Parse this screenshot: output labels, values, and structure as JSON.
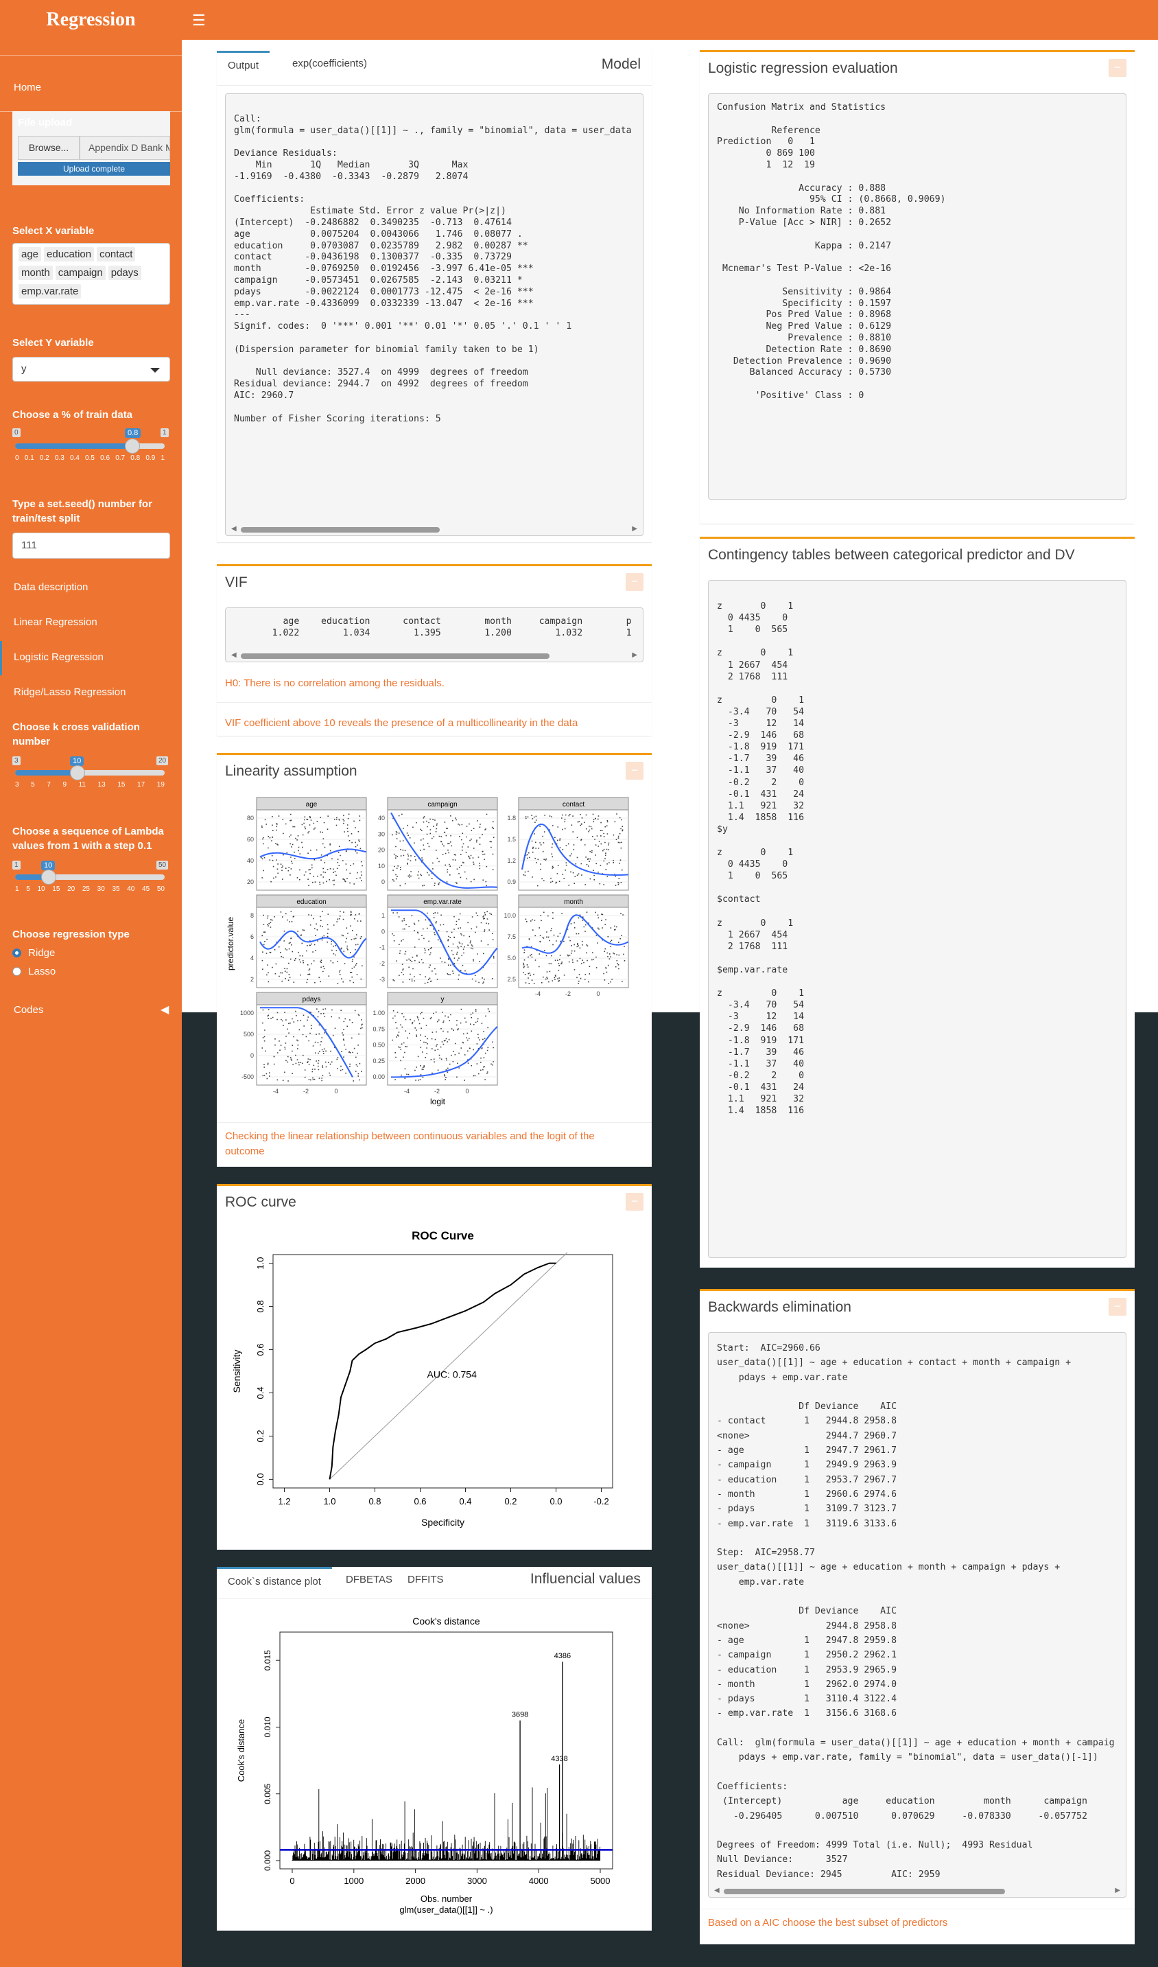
{
  "app": {
    "title": "Regression"
  },
  "sidebar": {
    "home": "Home",
    "file_upload_label": "File upload",
    "browse": "Browse...",
    "file_name": "Appendix D Bank Marketing.csv",
    "upload_status": "Upload complete",
    "x_label": "Select X variable",
    "x_chips": [
      "age",
      "education",
      "contact",
      "month",
      "campaign",
      "pdays",
      "emp.var.rate"
    ],
    "y_label": "Select Y variable",
    "y_value": "y",
    "train_label": "Choose a % of train data",
    "train_slider": {
      "min": "0",
      "max": "1",
      "value": "0.8",
      "value_fraction": 0.8,
      "ticks": [
        "0",
        "0.1",
        "0.2",
        "0.3",
        "0.4",
        "0.5",
        "0.6",
        "0.7",
        "0.8",
        "0.9",
        "1"
      ]
    },
    "seed_label": "Type a set.seed() number for train/test split",
    "seed_value": "111",
    "nav": [
      "Data description",
      "Linear Regression",
      "Logistic Regression",
      "Ridge/Lasso Regression"
    ],
    "k_label": "Choose k cross validation number",
    "k_slider": {
      "min": "3",
      "max": "20",
      "value": "10",
      "value_fraction": 0.41,
      "ticks": [
        "3",
        "5",
        "7",
        "9",
        "11",
        "13",
        "15",
        "17",
        "19"
      ]
    },
    "lambda_label": "Choose a sequence of Lambda values from 1 with a step 0.1",
    "lambda_slider": {
      "min": "1",
      "max": "50",
      "value": "10",
      "value_fraction": 0.18,
      "ticks": [
        "1",
        "5",
        "10",
        "15",
        "20",
        "25",
        "30",
        "35",
        "40",
        "45",
        "50"
      ]
    },
    "reg_label": "Choose regression type",
    "reg_options": [
      "Ridge",
      "Lasso"
    ],
    "codes": "Codes"
  },
  "model_box": {
    "title": "Model",
    "tabs": [
      "Output",
      "exp(coefficients)"
    ],
    "output": "\nCall:\nglm(formula = user_data()[[1]] ~ ., family = \"binomial\", data = user_data\n\nDeviance Residuals: \n    Min       1Q   Median       3Q      Max  \n-1.9169  -0.4380  -0.3343  -0.2879   2.8074  \n\nCoefficients:\n              Estimate Std. Error z value Pr(>|z|)    \n(Intercept)  -0.2486882  0.3490235  -0.713  0.47614    \nage           0.0075204  0.0043066   1.746  0.08077 .  \neducation     0.0703087  0.0235789   2.982  0.00287 ** \ncontact      -0.0436198  0.1300377  -0.335  0.73729    \nmonth        -0.0769250  0.0192456  -3.997 6.41e-05 ***\ncampaign     -0.0573451  0.0267585  -2.143  0.03211 *  \npdays        -0.0022124  0.0001773 -12.475  < 2e-16 ***\nemp.var.rate -0.4336099  0.0332339 -13.047  < 2e-16 ***\n---\nSignif. codes:  0 '***' 0.001 '**' 0.01 '*' 0.05 '.' 0.1 ' ' 1\n\n(Dispersion parameter for binomial family taken to be 1)\n\n    Null deviance: 3527.4  on 4999  degrees of freedom\nResidual deviance: 2944.7  on 4992  degrees of freedom\nAIC: 2960.7\n\nNumber of Fisher Scoring iterations: 5"
  },
  "vif_box": {
    "title": "VIF",
    "output": "         age    education      contact        month     campaign        p\n       1.022        1.034        1.395        1.200        1.032        1",
    "note1": "H0: There is no correlation among the residuals.",
    "note2": "VIF coefficient above 10 reveals the presence of a multicollinearity in the data"
  },
  "linearity_box": {
    "title": "Linearity assumption",
    "panels": [
      "age",
      "campaign",
      "contact",
      "education",
      "emp.var.rate",
      "month",
      "pdays",
      "y"
    ],
    "ylabel": "predictor.value",
    "xlabel": "logit",
    "note": "Checking the linear relationship between continuous variables and the logit of the outcome"
  },
  "roc_box": {
    "title": "ROC curve",
    "chart_title": "ROC Curve",
    "auc": "AUC: 0.754",
    "xlabel": "Specificity",
    "ylabel": "Sensitivity",
    "xticks": [
      "1.2",
      "1.0",
      "0.8",
      "0.6",
      "0.4",
      "0.2",
      "0.0",
      "-0.2"
    ],
    "yticks": [
      "0.0",
      "0.2",
      "0.4",
      "0.6",
      "0.8",
      "1.0"
    ]
  },
  "influence_box": {
    "title": "Influencial values",
    "tabs": [
      "Cook`s distance plot",
      "DFBETAS",
      "DFFITS"
    ],
    "chart_title": "Cook's distance",
    "ylabel": "Cook's distance",
    "xlabel": "Obs. number",
    "xlabel2": "glm(user_data()[[1]] ~ .)",
    "xticks": [
      "0",
      "1000",
      "2000",
      "3000",
      "4000",
      "5000"
    ],
    "yticks": [
      "0.000",
      "0.005",
      "0.010",
      "0.015"
    ],
    "labels": [
      "4386",
      "3698",
      "4338"
    ]
  },
  "eval_box": {
    "title": "Logistic regression evaluation",
    "output": "Confusion Matrix and Statistics\n\n          Reference\nPrediction   0   1\n         0 869 100\n         1  12  19\n                                          \n               Accuracy : 0.888           \n                 95% CI : (0.8668, 0.9069)\n    No Information Rate : 0.881           \n    P-Value [Acc > NIR] : 0.2652          \n                                          \n                  Kappa : 0.2147          \n                                          \n Mcnemar's Test P-Value : <2e-16          \n                                          \n            Sensitivity : 0.9864          \n            Specificity : 0.1597          \n         Pos Pred Value : 0.8968          \n         Neg Pred Value : 0.6129          \n             Prevalence : 0.8810          \n         Detection Rate : 0.8690          \n   Detection Prevalence : 0.9690          \n      Balanced Accuracy : 0.5730          \n                                          \n       'Positive' Class : 0               "
  },
  "contingency_box": {
    "title": "Contingency tables between categorical predictor and DV",
    "output": "\nz       0    1\n  0 4435    0\n  1    0  565\n\nz       0    1\n  1 2667  454\n  2 1768  111\n\nz         0    1\n  -3.4   70   54\n  -3     12   14\n  -2.9  146   68\n  -1.8  919  171\n  -1.7   39   46\n  -1.1   37   40\n  -0.2    2    0\n  -0.1  431   24\n  1.1   921   32\n  1.4  1858  116\n$y\n\nz       0    1\n  0 4435    0\n  1    0  565\n\n$contact\n\nz       0    1\n  1 2667  454\n  2 1768  111\n\n$emp.var.rate\n\nz         0    1\n  -3.4   70   54\n  -3     12   14\n  -2.9  146   68\n  -1.8  919  171\n  -1.7   39   46\n  -1.1   37   40\n  -0.2    2    0\n  -0.1  431   24\n  1.1   921   32\n  1.4  1858  116"
  },
  "backwards_box": {
    "title": "Backwards elimination",
    "output": "Start:  AIC=2960.66\nuser_data()[[1]] ~ age + education + contact + month + campaign + \n    pdays + emp.var.rate\n\n               Df Deviance    AIC\n- contact       1   2944.8 2958.8\n<none>              2944.7 2960.7\n- age           1   2947.7 2961.7\n- campaign      1   2949.9 2963.9\n- education     1   2953.7 2967.7\n- month         1   2960.6 2974.6\n- pdays         1   3109.7 3123.7\n- emp.var.rate  1   3119.6 3133.6\n\nStep:  AIC=2958.77\nuser_data()[[1]] ~ age + education + month + campaign + pdays + \n    emp.var.rate\n\n               Df Deviance    AIC\n<none>              2944.8 2958.8\n- age           1   2947.8 2959.8\n- campaign      1   2950.2 2962.1\n- education     1   2953.9 2965.9\n- month         1   2962.0 2974.0\n- pdays         1   3110.4 3122.4\n- emp.var.rate  1   3156.6 3168.6\n\nCall:  glm(formula = user_data()[[1]] ~ age + education + month + campaig\n    pdays + emp.var.rate, family = \"binomial\", data = user_data()[-1])\n\nCoefficients:\n (Intercept)           age     education         month      campaign  \n   -0.296405      0.007510      0.070629     -0.078330     -0.057752  \n\nDegrees of Freedom: 4999 Total (i.e. Null);  4993 Residual\nNull Deviance:\t    3527 \nResidual Deviance: 2945 \tAIC: 2959",
    "note": "Based on a AIC choose the best subset of predictors"
  },
  "colors": {
    "accent": "#EE7531",
    "box_border": "#F39C12",
    "dark_bg": "#222d32",
    "link_blue": "#3c8dbc"
  }
}
